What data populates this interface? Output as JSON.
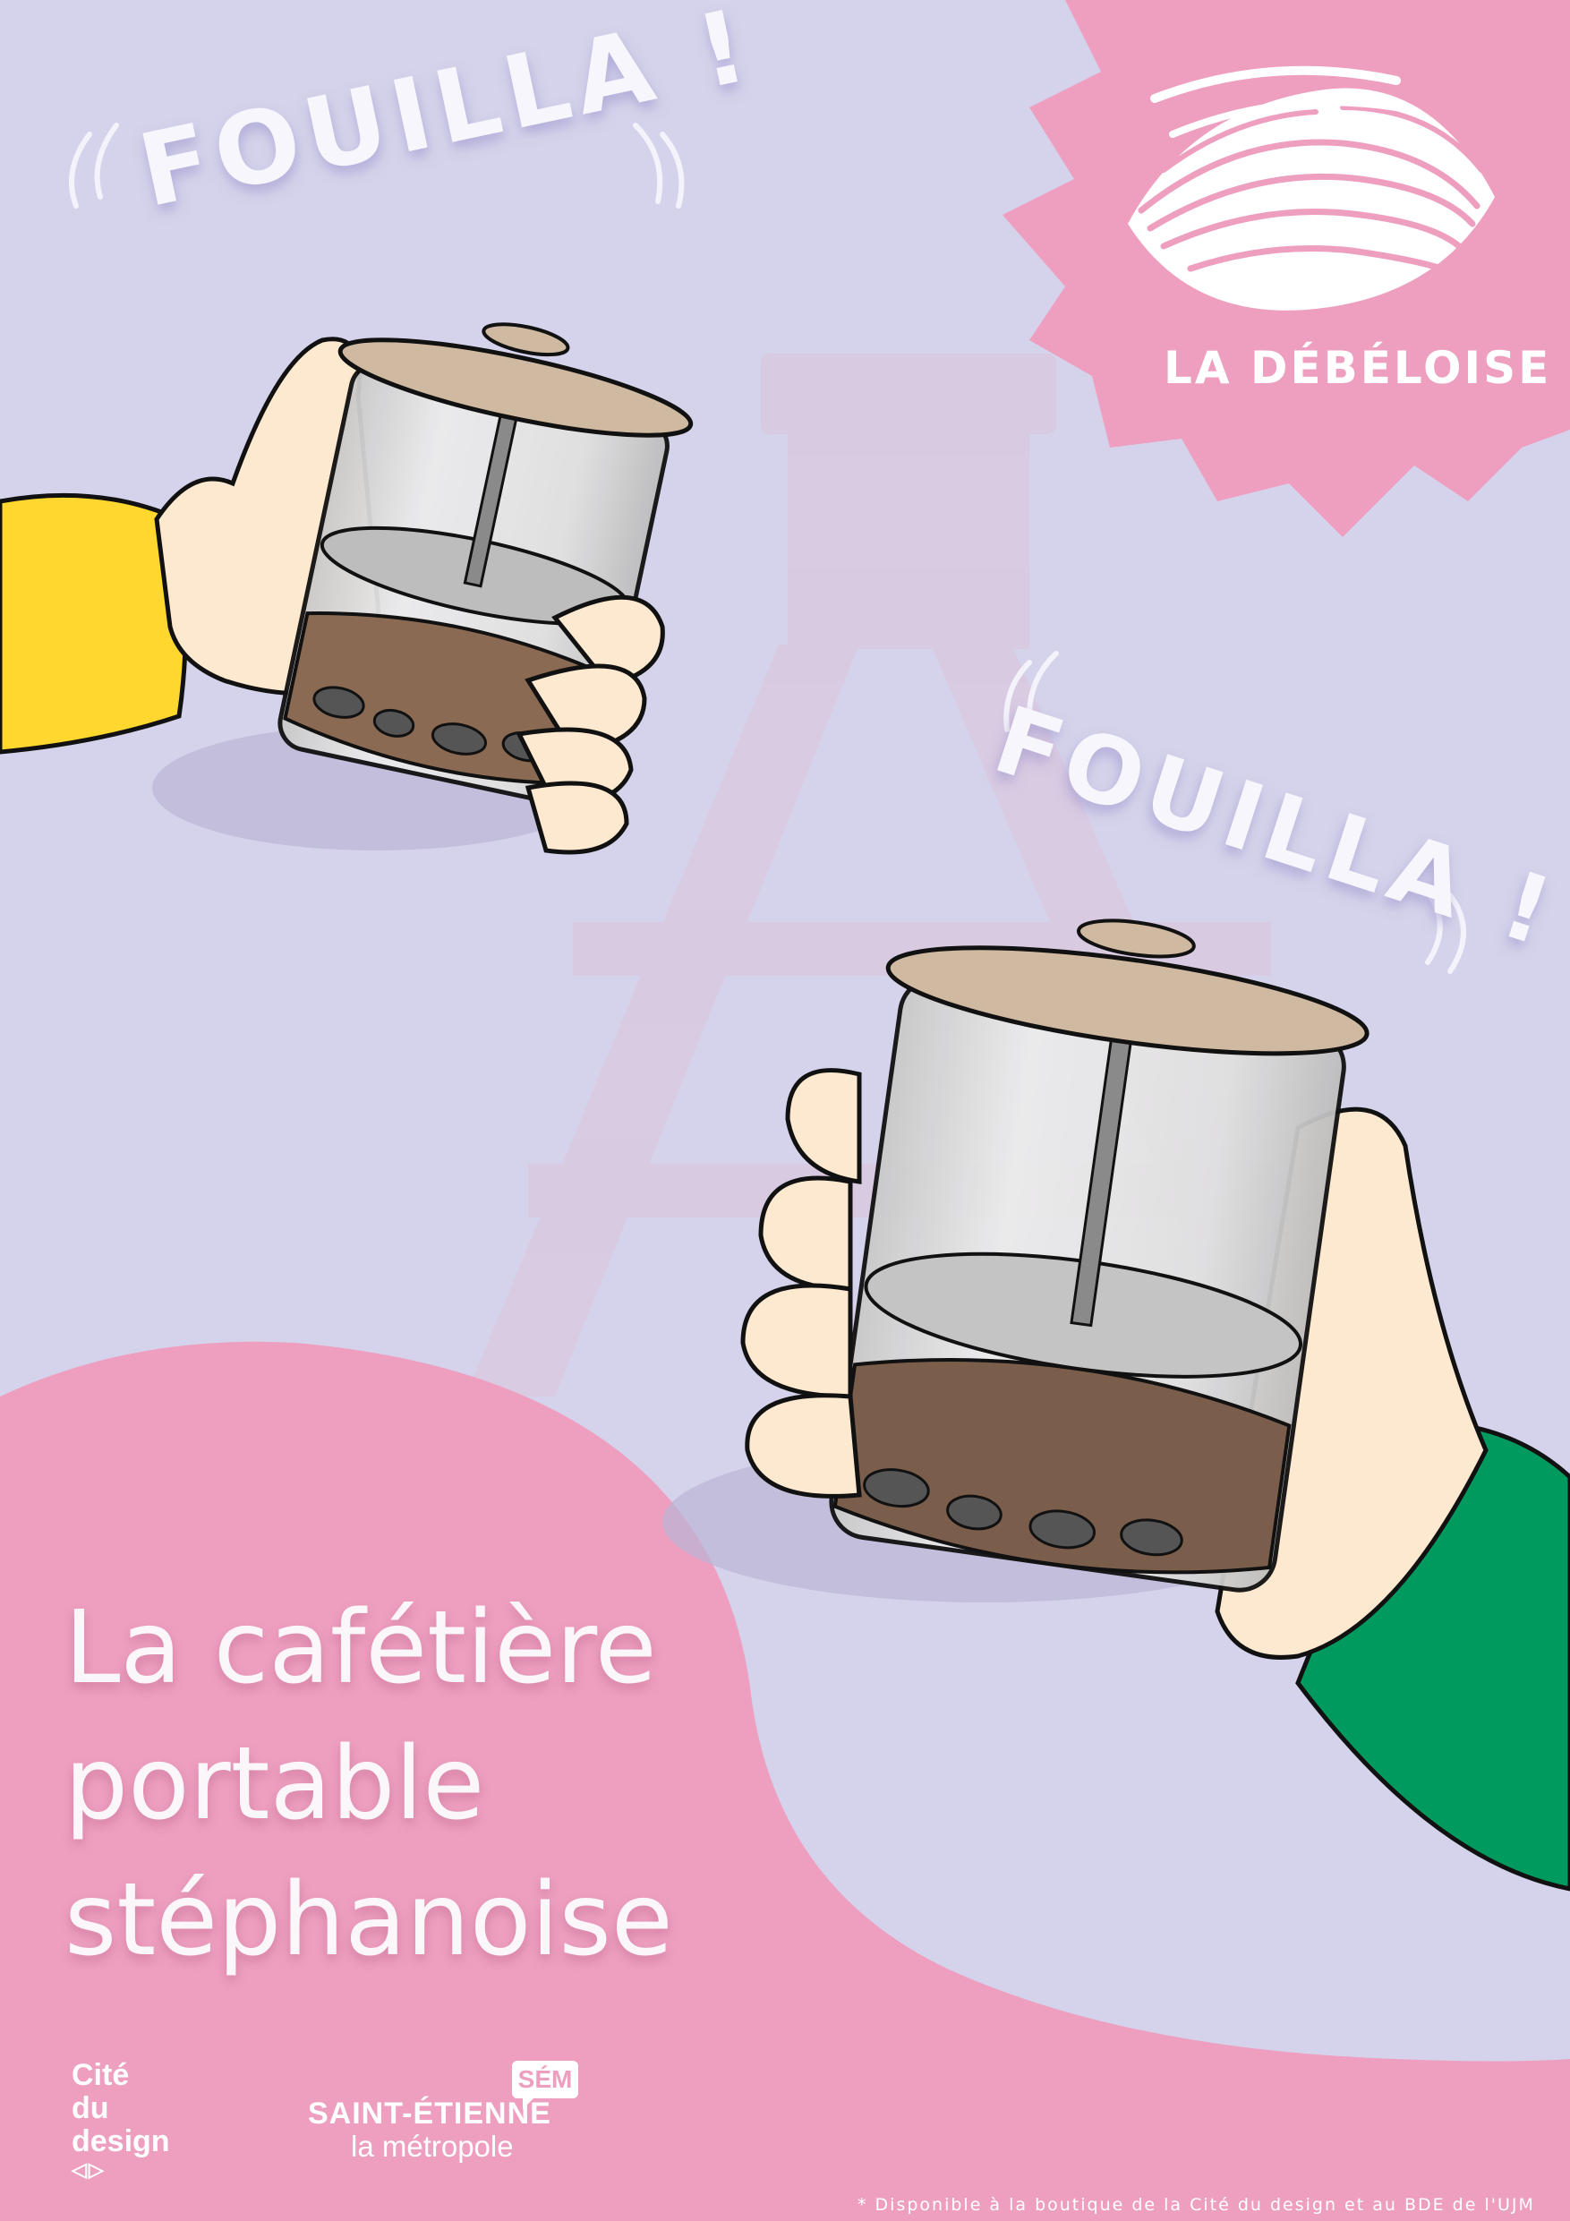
{
  "poster": {
    "exclamation_left": "FOUILLA !",
    "exclamation_right": "FOUILLA !",
    "brand_name": "LA DÉBÉLOISE",
    "headline": [
      "La cafétière",
      "portable",
      "stéphanoise"
    ],
    "footnote": "* Disponible à la boutique de la Cité du design et au BDE de l'UJM"
  },
  "logos": {
    "cite": {
      "lines": [
        "Cité",
        "du",
        "design"
      ],
      "mark": "◁▷"
    },
    "metropole": {
      "badge": "SÉM",
      "city": "SAINT-ÉTIENNE",
      "sub": "la métropole"
    }
  },
  "icons": [
    "brand-wave-icon",
    "sound-wave-icon",
    "french-press-icon",
    "hand-icon"
  ],
  "colors": {
    "background": "#d5d3eb",
    "pink": "#ee9fc0",
    "yellow_sleeve": "#ffd72e",
    "green_sleeve": "#009a5e",
    "skin": "#fde9cf",
    "lid_wood": "#cfb9a0",
    "coffee": "#7a5e4b",
    "text_white": "#ffffff"
  }
}
